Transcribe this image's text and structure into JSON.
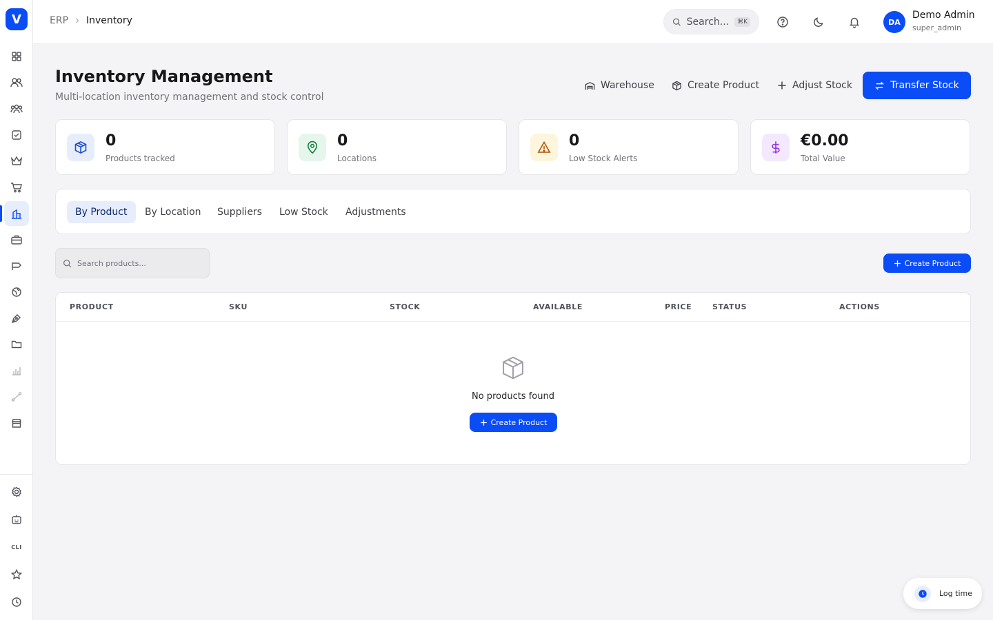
{
  "app": {
    "logo_letter": "V",
    "brand_color": "#0a4cf5"
  },
  "sidebar": {
    "items": [
      {
        "icon": "grid-icon"
      },
      {
        "icon": "users-icon"
      },
      {
        "icon": "team-icon"
      },
      {
        "icon": "checkbox-icon"
      },
      {
        "icon": "crown-icon"
      },
      {
        "icon": "cart-icon"
      },
      {
        "icon": "building-icon",
        "active": true
      },
      {
        "icon": "briefcase-icon"
      },
      {
        "icon": "megaphone-icon"
      },
      {
        "icon": "globe-icon"
      },
      {
        "icon": "pen-icon"
      },
      {
        "icon": "folder-icon"
      },
      {
        "icon": "chart-icon"
      },
      {
        "icon": "route-icon"
      },
      {
        "icon": "store-icon"
      }
    ],
    "bottom": [
      {
        "icon": "settings-icon"
      },
      {
        "icon": "robot-icon"
      },
      {
        "label": "CLI"
      },
      {
        "icon": "star-icon"
      },
      {
        "icon": "clock-icon"
      }
    ]
  },
  "topbar": {
    "breadcrumb": {
      "root": "ERP",
      "current": "Inventory"
    },
    "search_placeholder": "Search...",
    "shortcut": "⌘K",
    "user": {
      "initials": "DA",
      "name": "Demo Admin",
      "role": "super_admin"
    }
  },
  "header": {
    "title": "Inventory Management",
    "subtitle": "Multi-location inventory management and stock control",
    "actions": {
      "warehouse": "Warehouse",
      "create_product": "Create Product",
      "adjust_stock": "Adjust Stock",
      "transfer_stock": "Transfer Stock"
    }
  },
  "stats": [
    {
      "value": "0",
      "label": "Products tracked",
      "icon": "box-icon",
      "color": "#1d4ed8",
      "bg": "#e7edfb"
    },
    {
      "value": "0",
      "label": "Locations",
      "icon": "map-pin-icon",
      "color": "#15803d",
      "bg": "#e6f6ec"
    },
    {
      "value": "0",
      "label": "Low Stock Alerts",
      "icon": "warning-icon",
      "color": "#b45309",
      "bg": "#fdf6dc"
    },
    {
      "value": "€0.00",
      "label": "Total Value",
      "icon": "dollar-icon",
      "color": "#9333ea",
      "bg": "#f3e8fd"
    }
  ],
  "tabs": [
    "By Product",
    "By Location",
    "Suppliers",
    "Low Stock",
    "Adjustments"
  ],
  "active_tab": "By Product",
  "toolbar": {
    "search_placeholder": "Search products...",
    "create_label": "Create Product"
  },
  "table": {
    "columns": [
      "PRODUCT",
      "SKU",
      "STOCK",
      "AVAILABLE",
      "PRICE",
      "STATUS",
      "ACTIONS"
    ],
    "rows": [],
    "empty_text": "No products found",
    "empty_action": "Create Product"
  },
  "log_time": {
    "label": "Log time"
  }
}
